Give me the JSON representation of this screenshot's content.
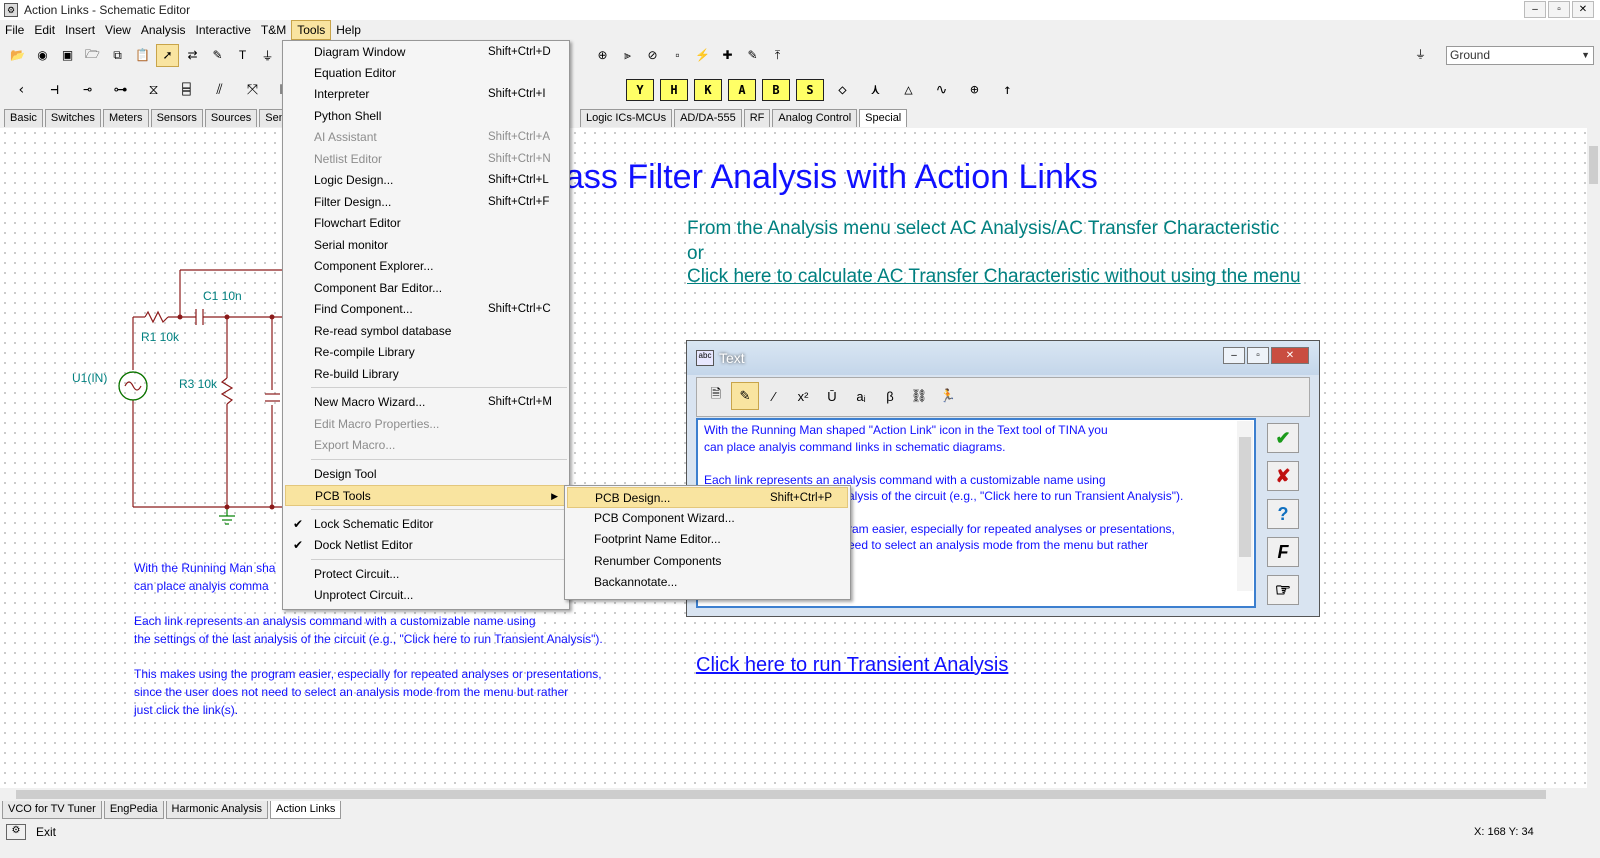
{
  "window": {
    "title": "Action Links - Schematic Editor"
  },
  "menubar": [
    "File",
    "Edit",
    "Insert",
    "View",
    "Analysis",
    "Interactive",
    "T&M",
    "Tools",
    "Help"
  ],
  "ground_select": {
    "value": "Ground"
  },
  "component_tabs_left": [
    "Basic",
    "Switches",
    "Meters",
    "Sensors",
    "Sources",
    "Semicon"
  ],
  "component_tabs_right": [
    "Logic ICs-MCUs",
    "AD/DA-555",
    "RF",
    "Analog Control",
    "Special"
  ],
  "component_yellow": [
    "Y",
    "H",
    "K",
    "A",
    "B",
    "S"
  ],
  "tools_menu": [
    {
      "label": "Diagram Window",
      "shortcut": "Shift+Ctrl+D"
    },
    {
      "label": "Equation Editor",
      "shortcut": ""
    },
    {
      "label": "Interpreter",
      "shortcut": "Shift+Ctrl+I"
    },
    {
      "label": "Python Shell",
      "shortcut": ""
    },
    {
      "label": "AI Assistant",
      "shortcut": "Shift+Ctrl+A"
    },
    {
      "label": "Netlist Editor",
      "shortcut": "Shift+Ctrl+N"
    },
    {
      "label": "Logic Design...",
      "shortcut": "Shift+Ctrl+L"
    },
    {
      "label": "Filter Design...",
      "shortcut": "Shift+Ctrl+F"
    },
    {
      "label": "Flowchart Editor",
      "shortcut": ""
    },
    {
      "label": "Serial monitor",
      "shortcut": ""
    },
    {
      "label": "Component Explorer...",
      "shortcut": ""
    },
    {
      "label": "Component Bar Editor...",
      "shortcut": ""
    },
    {
      "label": "Find Component...",
      "shortcut": "Shift+Ctrl+C"
    },
    {
      "label": "Re-read symbol database",
      "shortcut": ""
    },
    {
      "label": "Re-compile Library",
      "shortcut": ""
    },
    {
      "label": "Re-build Library",
      "shortcut": ""
    },
    {
      "label": "New Macro Wizard...",
      "shortcut": "Shift+Ctrl+M"
    },
    {
      "label": "Edit Macro Properties...",
      "shortcut": ""
    },
    {
      "label": "Export Macro...",
      "shortcut": ""
    },
    {
      "label": "Design Tool",
      "shortcut": ""
    },
    {
      "label": "PCB Tools",
      "shortcut": ""
    },
    {
      "label": "Lock Schematic Editor",
      "shortcut": ""
    },
    {
      "label": "Dock Netlist Editor",
      "shortcut": ""
    },
    {
      "label": "Protect Circuit...",
      "shortcut": ""
    },
    {
      "label": "Unprotect Circuit...",
      "shortcut": ""
    }
  ],
  "pcb_submenu": [
    {
      "label": "PCB Design...",
      "shortcut": "Shift+Ctrl+P"
    },
    {
      "label": "PCB Component Wizard...",
      "shortcut": ""
    },
    {
      "label": "Footprint Name Editor...",
      "shortcut": ""
    },
    {
      "label": "Renumber Components",
      "shortcut": ""
    },
    {
      "label": "Backannotate...",
      "shortcut": ""
    }
  ],
  "canvas": {
    "title": "ass Filter Analysis with Action Links",
    "instr1": "From the  Analysis menu select AC Analysis/AC Transfer Characteristic",
    "instr2": "or",
    "link_ac": "Click here to calculate AC Transfer Characteristic without using the menu",
    "link_transient": "Click here to run Transient Analysis",
    "schematic_labels": {
      "c1": "C1 10n",
      "r1": "R1 10k",
      "r3": "R3 10k",
      "u1": "U1(IN)"
    },
    "body_lines": [
      "With the Running Man sha",
      "can place analyis comma",
      "Each link represents an analysis command with a customizable name using",
      "the settings of the last analysis of the circuit (e.g., \"Click here to run Transient Analysis\").",
      "This makes using the program easier, especially for repeated analyses or presentations,",
      "since the user does not need to select an analysis mode from the menu but rather",
      "just click the link(s)."
    ]
  },
  "text_window": {
    "title": "Text",
    "lines": [
      "With the Running Man shaped \"Action Link\" icon in the Text tool of TINA you",
      "can place analyis command links in schematic diagrams.",
      "Each link represents an analysis command with a customizable name using",
      "alysis of the circuit (e.g., \"Click here to run Transient Analysis\").",
      "ram easier, especially for repeated analyses or presentations,",
      "eed to select an analysis mode from the menu but rather"
    ]
  },
  "doc_tabs": [
    "VCO for TV Tuner",
    "EngPedia",
    "Harmonic Analysis",
    "Action Links"
  ],
  "status": {
    "exit": "Exit",
    "coords": "X: 168  Y: 34"
  }
}
